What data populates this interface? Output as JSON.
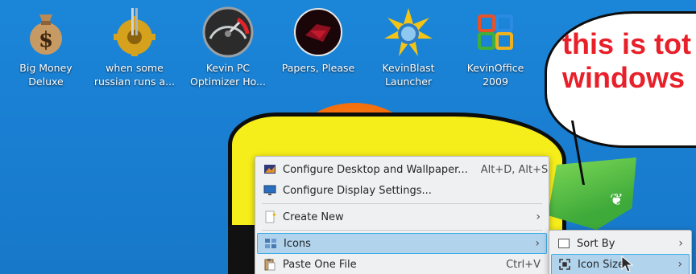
{
  "desktop": {
    "icons": [
      {
        "label": "Big Money\nDeluxe",
        "icon": "money-bag-icon"
      },
      {
        "label": "when some\nrussian runs a...",
        "icon": "gear-icon"
      },
      {
        "label": "Kevin PC\nOptimizer Ho...",
        "icon": "speedometer-icon"
      },
      {
        "label": "Papers, Please",
        "icon": "papers-please-icon"
      },
      {
        "label": "KevinBlast\nLauncher",
        "icon": "starburst-icon"
      },
      {
        "label": "KevinOffice\n2009",
        "icon": "office-logo-icon"
      }
    ],
    "bubble_text_line1": "this is tot",
    "bubble_text_line2": "windows",
    "colors": {
      "bubble_text": "#e8202a",
      "menu_highlight": "#b2d3ec",
      "menu_highlight_border": "#3daee9"
    }
  },
  "context_menu": {
    "items": [
      {
        "label": "Configure Desktop and Wallpaper...",
        "shortcut": "Alt+D, Alt+S",
        "icon": "desktop-wallpaper-icon"
      },
      {
        "label": "Configure Display Settings...",
        "shortcut": "",
        "icon": "display-icon"
      },
      {
        "label": "Create New",
        "shortcut": "",
        "icon": "new-document-icon",
        "submenu": true
      },
      {
        "label": "Icons",
        "shortcut": "",
        "icon": "icons-grid-icon",
        "submenu": true,
        "active": true
      },
      {
        "label": "Paste One File",
        "shortcut": "Ctrl+V",
        "icon": "paste-icon"
      }
    ]
  },
  "icons_submenu": {
    "items": [
      {
        "label": "Sort By",
        "icon": "sort-box-icon",
        "submenu": true
      },
      {
        "label": "Icon Size",
        "icon": "resize-icon",
        "submenu": true,
        "active": true
      }
    ]
  }
}
